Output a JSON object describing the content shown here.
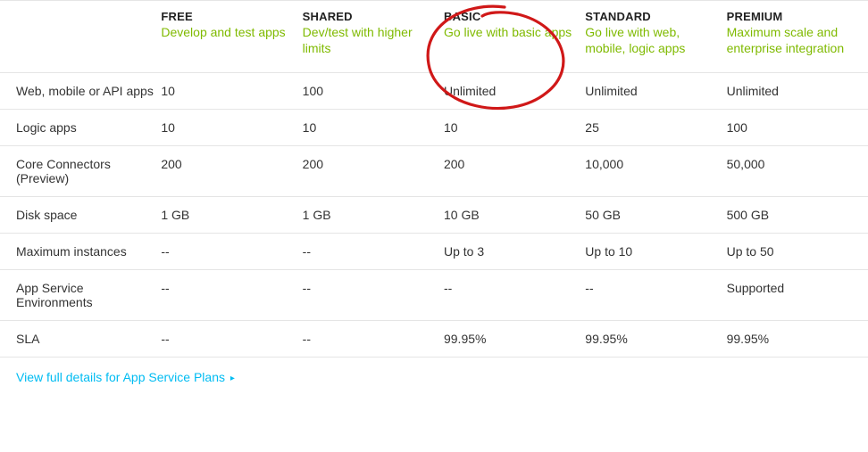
{
  "plans": [
    {
      "name": "FREE",
      "subtitle": "Develop and test apps"
    },
    {
      "name": "SHARED",
      "subtitle": "Dev/test with higher limits"
    },
    {
      "name": "BASIC",
      "subtitle": "Go live with basic apps"
    },
    {
      "name": "STANDARD",
      "subtitle": "Go live with web, mobile, logic apps"
    },
    {
      "name": "PREMIUM",
      "subtitle": "Maximum scale and enterprise integration"
    }
  ],
  "rows": [
    {
      "feature": "Web, mobile or API apps",
      "values": [
        "10",
        "100",
        "Unlimited",
        "Unlimited",
        "Unlimited"
      ]
    },
    {
      "feature": "Logic apps",
      "values": [
        "10",
        "10",
        "10",
        "25",
        "100"
      ]
    },
    {
      "feature": "Core Connectors (Preview)",
      "values": [
        "200",
        "200",
        "200",
        "10,000",
        "50,000"
      ]
    },
    {
      "feature": "Disk space",
      "values": [
        "1 GB",
        "1 GB",
        "10 GB",
        "50 GB",
        "500 GB"
      ]
    },
    {
      "feature": "Maximum instances",
      "values": [
        "--",
        "--",
        "Up to 3",
        "Up to 10",
        "Up to 50"
      ]
    },
    {
      "feature": "App Service Environments",
      "values": [
        "--",
        "--",
        "--",
        "--",
        "Supported"
      ]
    },
    {
      "feature": "SLA",
      "values": [
        "--",
        "--",
        "99.95%",
        "99.95%",
        "99.95%"
      ]
    }
  ],
  "footer_link": "View full details for App Service Plans",
  "footer_arrow": "▸"
}
